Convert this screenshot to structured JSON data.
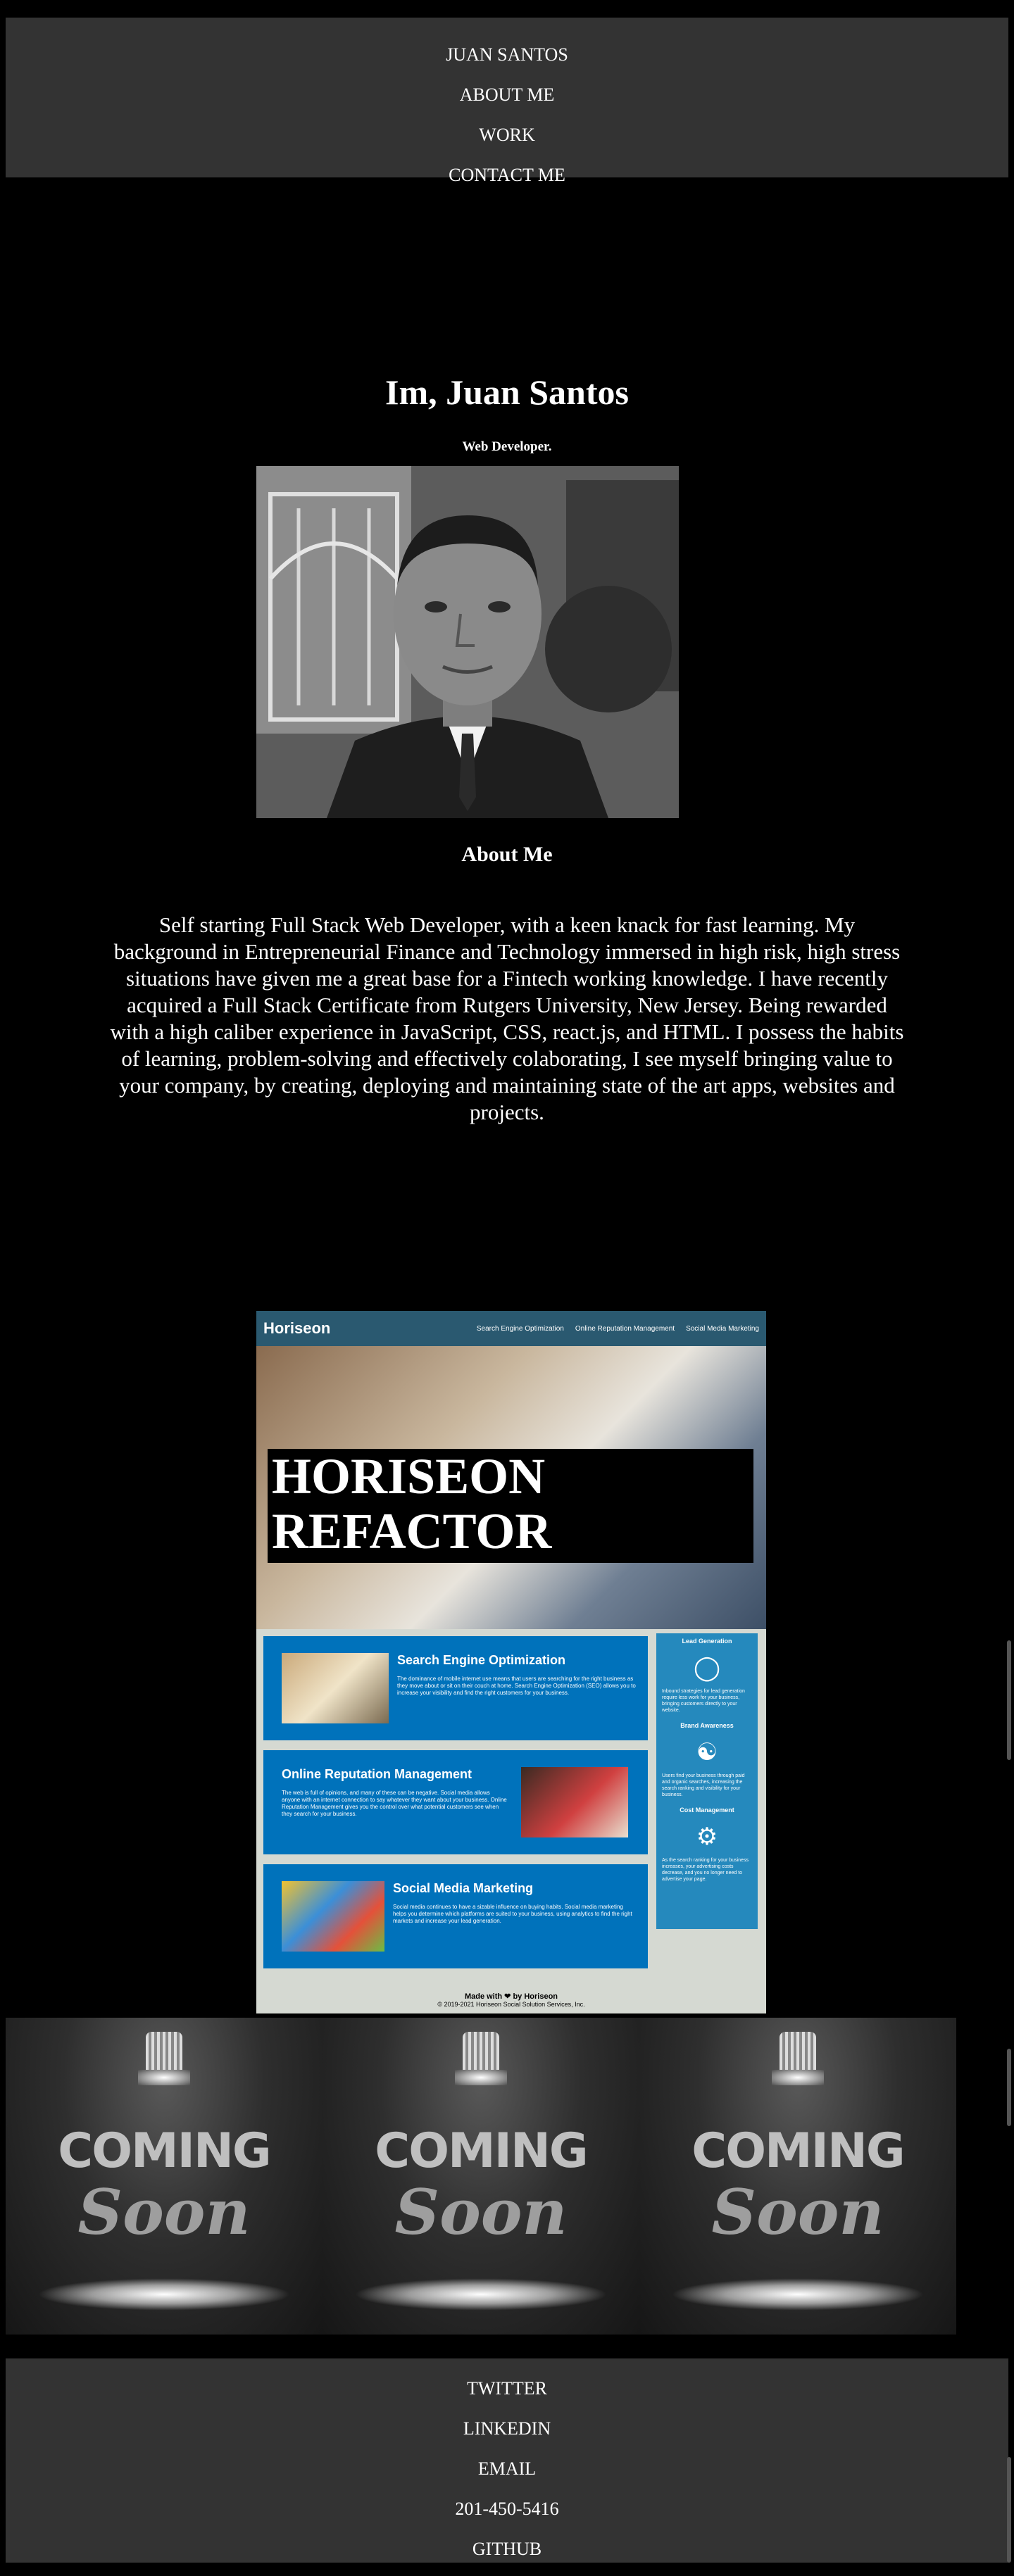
{
  "nav": {
    "items": [
      "JUAN SANTOS",
      "ABOUT ME",
      "WORK",
      "CONTACT ME"
    ]
  },
  "hero": {
    "title": "Im, Juan Santos",
    "subtitle": "Web Developer."
  },
  "about": {
    "heading": "About Me",
    "text": "Self starting Full Stack Web Developer, with a keen knack for fast learning. My background in Entrepreneurial Finance and Technology immersed in high risk, high stress situations have given me a great base for a Fintech working knowledge. I have recently acquired a Full Stack Certificate from Rutgers University, New Jersey. Being rewarded with a high caliber experience in JavaScript, CSS, react.js, and HTML. I possess the habits of learning, problem-solving and effectively colaborating, I see myself bringing value to your company, by creating, deploying and maintaining state of the art apps, websites and projects."
  },
  "project": {
    "logo": "Horiseon",
    "nav": [
      "Search Engine Optimization",
      "Online Reputation Management",
      "Social Media Marketing"
    ],
    "hero_text": "HORISEON REFACTOR",
    "cards": [
      {
        "title": "Search Engine Optimization",
        "text": "The dominance of mobile internet use means that users are searching for the right business as they move about or sit on their couch at home. Search Engine Optimization (SEO) allows you to increase your visibility and find the right customers for your business."
      },
      {
        "title": "Online Reputation Management",
        "text": "The web is full of opinions, and many of these can be negative. Social media allows anyone with an internet connection to say whatever they want about your business. Online Reputation Management gives you the control over what potential customers see when they search for your business."
      },
      {
        "title": "Social Media Marketing",
        "text": "Social media continues to have a sizable influence on buying habits. Social media marketing helps you determine which platforms are suited to your business, using analytics to find the right markets and increase your lead generation."
      }
    ],
    "side": [
      {
        "title": "Lead Generation",
        "text": "Inbound strategies for lead generation require less work for your business, bringing customers directly to your website."
      },
      {
        "title": "Brand Awareness",
        "text": "Users find your business through paid and organic searches, increasing the search ranking and visibility for your business."
      },
      {
        "title": "Cost Management",
        "text": "As the search ranking for your business increases, your advertising costs decrease, and you no longer need to advertise your page."
      }
    ],
    "footer_line1": "Made with ❤ by Horiseon",
    "footer_line2": "© 2019-2021 Horiseon Social Solution Services, Inc."
  },
  "coming_soon": {
    "word1": "COMING",
    "word2": "Soon",
    "panels": 3
  },
  "footer": {
    "items": [
      "TWITTER",
      "LINKEDIN",
      "EMAIL",
      "201-450-5416",
      "GITHUB"
    ]
  },
  "colors": {
    "background": "#000000",
    "bar": "#333333",
    "horiseon_header": "#2a5970",
    "horiseon_card": "#0072bb",
    "horiseon_side": "#2589bd"
  }
}
